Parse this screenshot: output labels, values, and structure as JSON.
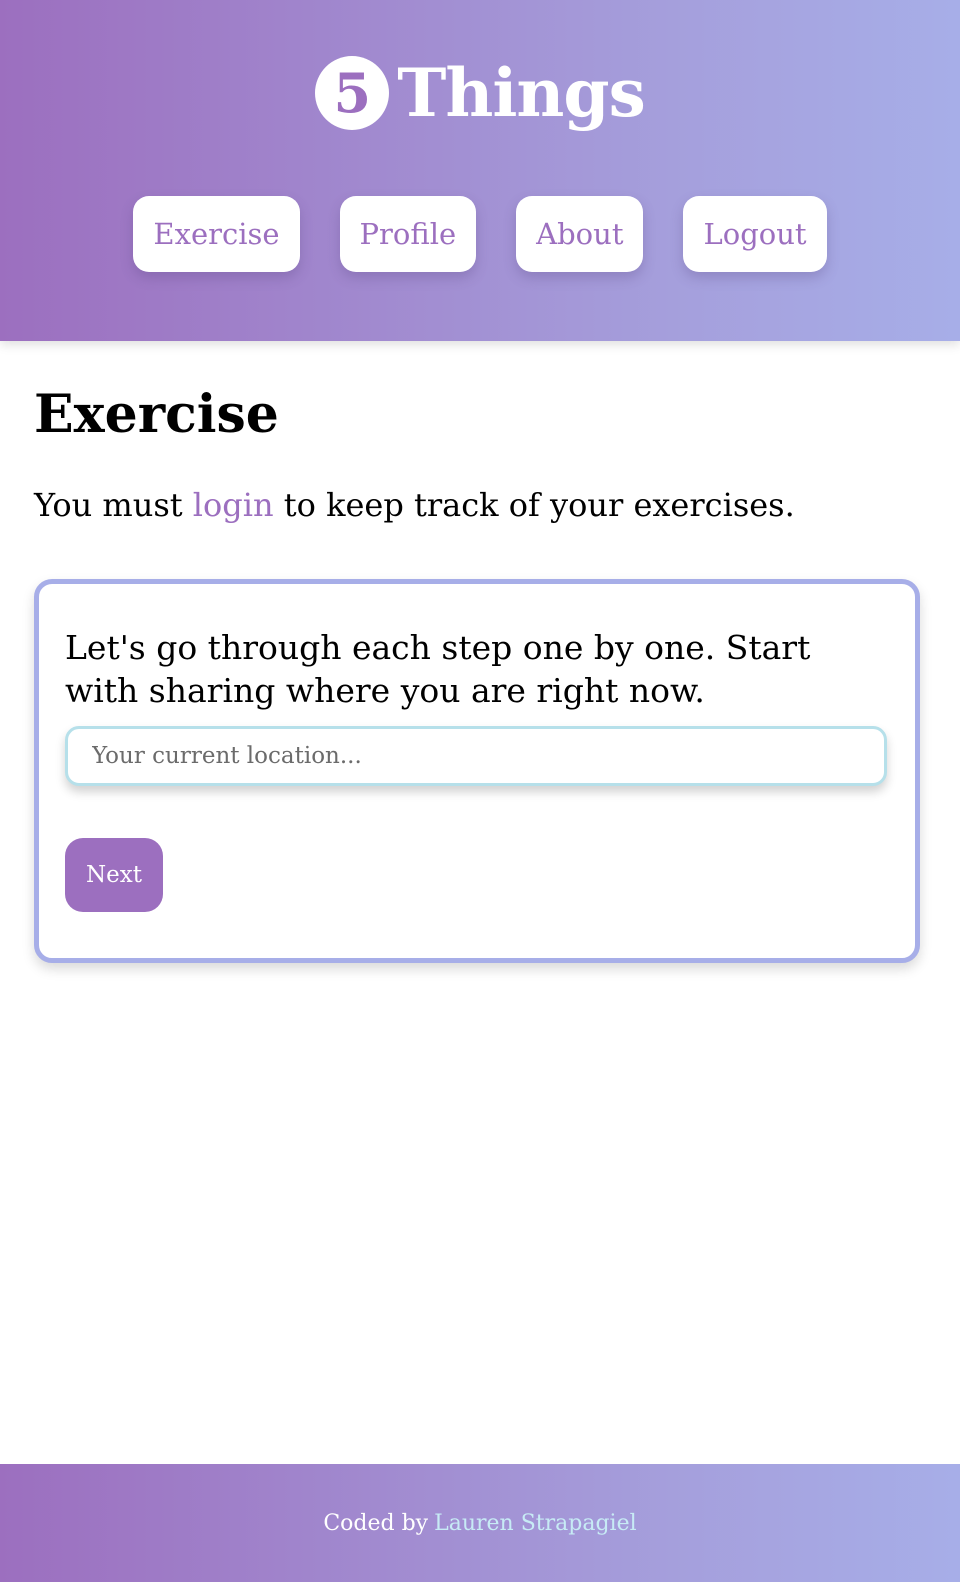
{
  "brand": {
    "logo_number": "5",
    "name": "Things"
  },
  "nav": {
    "items": [
      {
        "label": "Exercise"
      },
      {
        "label": "Profile"
      },
      {
        "label": "About"
      },
      {
        "label": "Logout"
      }
    ]
  },
  "main": {
    "title": "Exercise",
    "notice_before": "You must",
    "notice_link": "login",
    "notice_after": "to keep track of your exercises."
  },
  "exercise_card": {
    "prompt": "Let's go through each step one by one. Start with sharing where you are right now.",
    "location_input": {
      "value": "",
      "placeholder": "Your current location..."
    },
    "next_label": "Next"
  },
  "footer": {
    "prefix": "Coded by",
    "author_link": "Lauren Strapagiel"
  },
  "colors": {
    "brand_purple": "#9c6fbf",
    "gradient_end": "#a7aee8",
    "input_border": "#b6e0ea",
    "footer_link": "#c7ebf5"
  }
}
